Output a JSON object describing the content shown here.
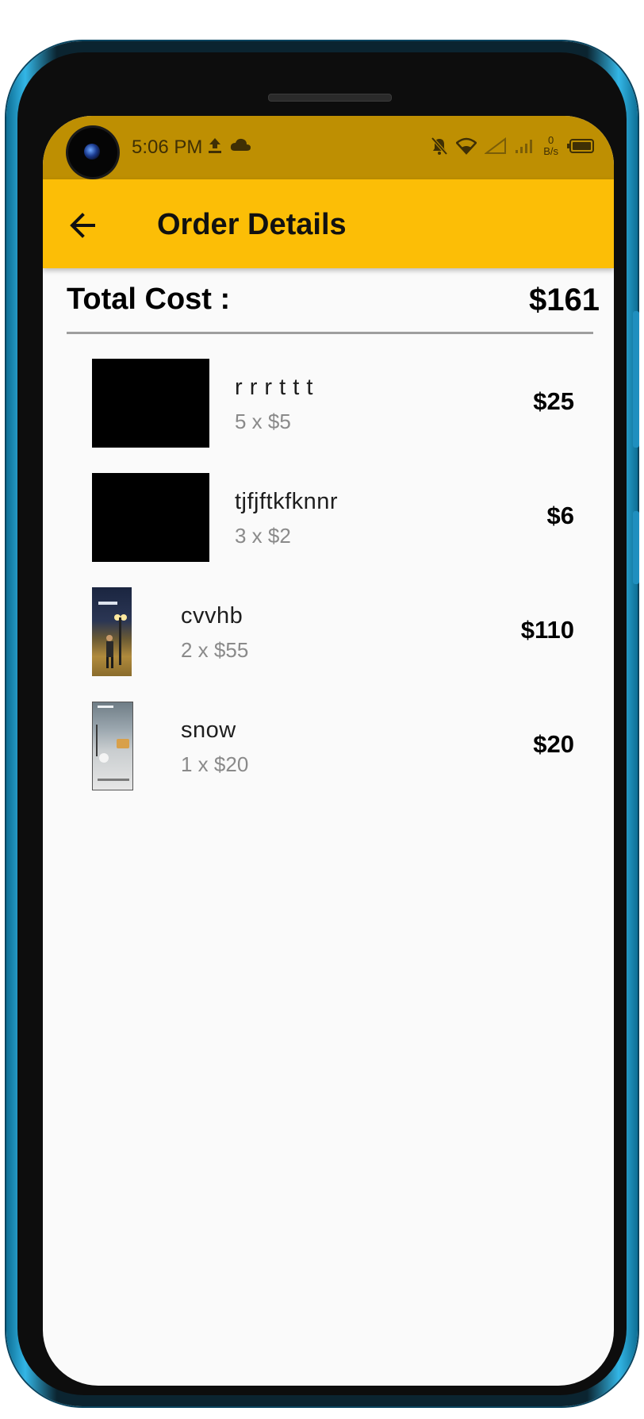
{
  "status_bar": {
    "time": "5:06 PM",
    "net_speed_value": "0",
    "net_speed_unit": "B/s",
    "icons": [
      "upload-icon",
      "cloud-icon",
      "mute-icon",
      "wifi-icon",
      "signal-icon",
      "battery-icon"
    ]
  },
  "app_bar": {
    "title": "Order Details",
    "back_icon": "arrow-left-icon",
    "color": "#fcbe06"
  },
  "summary": {
    "label": "Total Cost :",
    "value": "$161"
  },
  "items": [
    {
      "name": "r r r t t t",
      "qty": "5 x $5",
      "price": "$25"
    },
    {
      "name": "tjfjftkfknnr",
      "qty": "3 x $2",
      "price": "$6"
    },
    {
      "name": "cvvhb",
      "qty": "2 x $55",
      "price": "$110"
    },
    {
      "name": "snow",
      "qty": "1 x $20",
      "price": "$20"
    }
  ],
  "colors": {
    "status_bar": "#be8f02",
    "app_bar": "#fcbe06",
    "background": "#fafafa"
  }
}
